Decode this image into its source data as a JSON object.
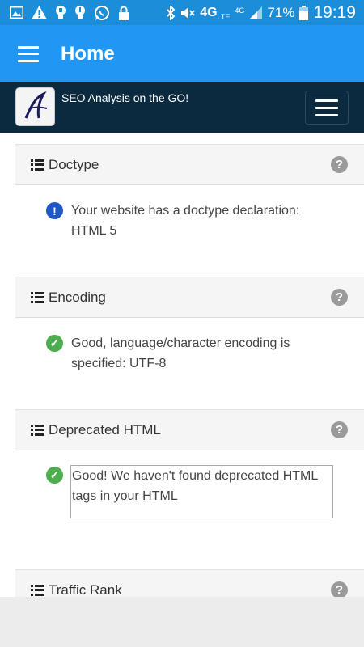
{
  "statusbar": {
    "network": "4G",
    "network_sub": "LTE",
    "network2": "4G",
    "battery": "71%",
    "time": "19:19",
    "icons": [
      "picture-icon",
      "warning-icon",
      "bulb-icon",
      "bulb-icon",
      "whatsapp-icon",
      "lock-icon",
      "bluetooth-icon",
      "mute-icon",
      "signal-icon",
      "battery-icon"
    ]
  },
  "appbar": {
    "title": "Home"
  },
  "sitebar": {
    "tagline": "SEO Analysis on the GO!"
  },
  "sections": [
    {
      "title": "Doctype",
      "status": "info",
      "message": "Your website has a doctype declaration: HTML 5"
    },
    {
      "title": "Encoding",
      "status": "ok",
      "message": "Good, language/character encoding is specified: UTF-8"
    },
    {
      "title": "Deprecated HTML",
      "status": "ok",
      "message": "Good! We haven't found deprecated HTML tags in your HTML"
    },
    {
      "title": "Traffic Rank"
    }
  ],
  "colors": {
    "statusbar": "#1c8ed9",
    "appbar": "#2196f3",
    "sitebar": "#0c2a3f",
    "ok": "#4cae4f",
    "info": "#1f57c7"
  }
}
